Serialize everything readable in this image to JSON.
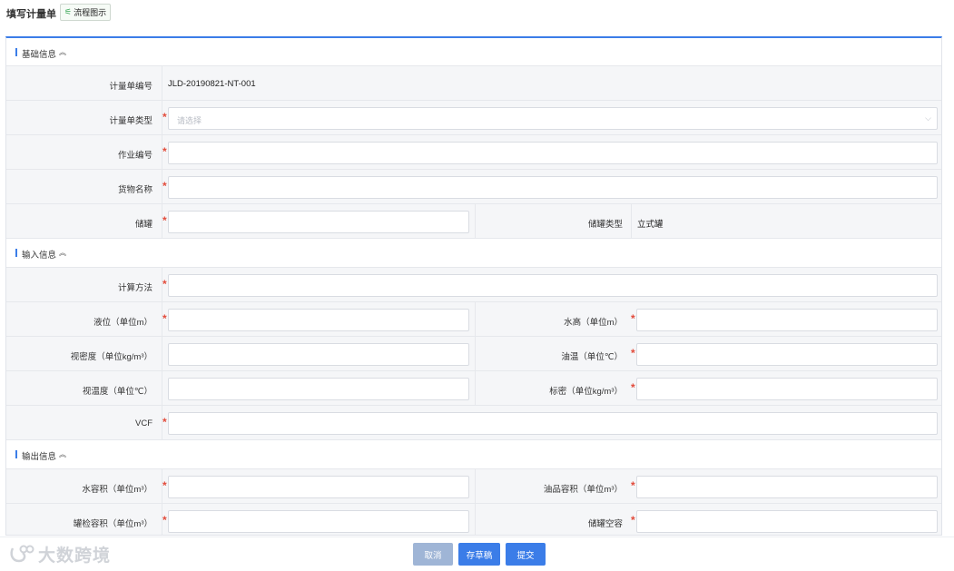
{
  "header": {
    "title": "填写计量单",
    "flow_button": "流程图示",
    "flow_icon": "flow-chart-icon"
  },
  "sections": {
    "basic": "基础信息",
    "input": "输入信息",
    "output": "输出信息"
  },
  "basic": {
    "meter_no_label": "计量单编号",
    "meter_no_value": "JLD-20190821-NT-001",
    "meter_type_label": "计量单类型",
    "meter_type_placeholder": "请选择",
    "job_no_label": "作业编号",
    "goods_label": "货物名称",
    "tank_label": "储罐",
    "tank_type_label": "储罐类型",
    "tank_type_value": "立式罐"
  },
  "input": {
    "calc_method": "计算方法",
    "level": "液位（单位m）",
    "water_height": "水高（单位m）",
    "apparent_density": "视密度（单位kg/m³）",
    "oil_temp": "油温（单位℃）",
    "apparent_temp": "视温度（单位℃）",
    "std_density": "标密（单位kg/m³）",
    "vcf": "VCF"
  },
  "output": {
    "water_volume": "水容积（单位m³）",
    "oil_volume": "油品容积（单位m³）",
    "tank_check_volume": "罐检容积（单位m³）",
    "tank_empty": "储罐空容"
  },
  "footer": {
    "cancel": "取消",
    "save_draft": "存草稿",
    "submit": "提交"
  },
  "watermark": "大数跨境",
  "colors": {
    "accent": "#3b7de8",
    "required": "#e24b3b",
    "cancel": "#9fb5d6"
  }
}
